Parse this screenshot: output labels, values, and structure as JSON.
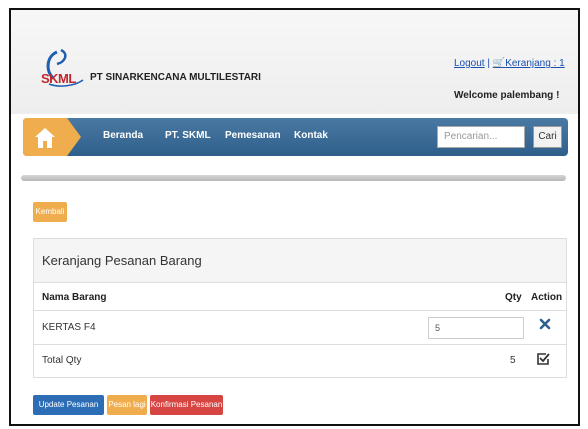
{
  "header": {
    "logo_text": "SKML",
    "company_name": "PT SINARKENCANA MULTILESTARI",
    "logout_label": "Logout",
    "separator": " | ",
    "cart_label": "Keranjang : 1",
    "welcome_text": "Welcome palembang !"
  },
  "nav": {
    "items": [
      {
        "label": "Beranda"
      },
      {
        "label": "PT. SKML"
      },
      {
        "label": "Pemesanan"
      },
      {
        "label": "Kontak"
      }
    ],
    "search_placeholder": "Pencarian...",
    "search_button": "Cari"
  },
  "back_button": "Kembali",
  "cart": {
    "title": "Keranjang Pesanan Barang",
    "columns": [
      "Nama Barang",
      "Qty",
      "Action"
    ],
    "rows": [
      {
        "name": "KERTAS F4",
        "qty": "5"
      }
    ],
    "total_label": "Total Qty",
    "total_qty": "5"
  },
  "buttons": {
    "update": "Update Pesanan",
    "pesan_lagi": "Pesan lagi",
    "konfirmasi": "Konfirmasi Pesanan"
  },
  "colors": {
    "nav": "#2e5f8a",
    "warning": "#f0ad4e",
    "primary": "#2d6db5",
    "danger": "#d64541"
  }
}
